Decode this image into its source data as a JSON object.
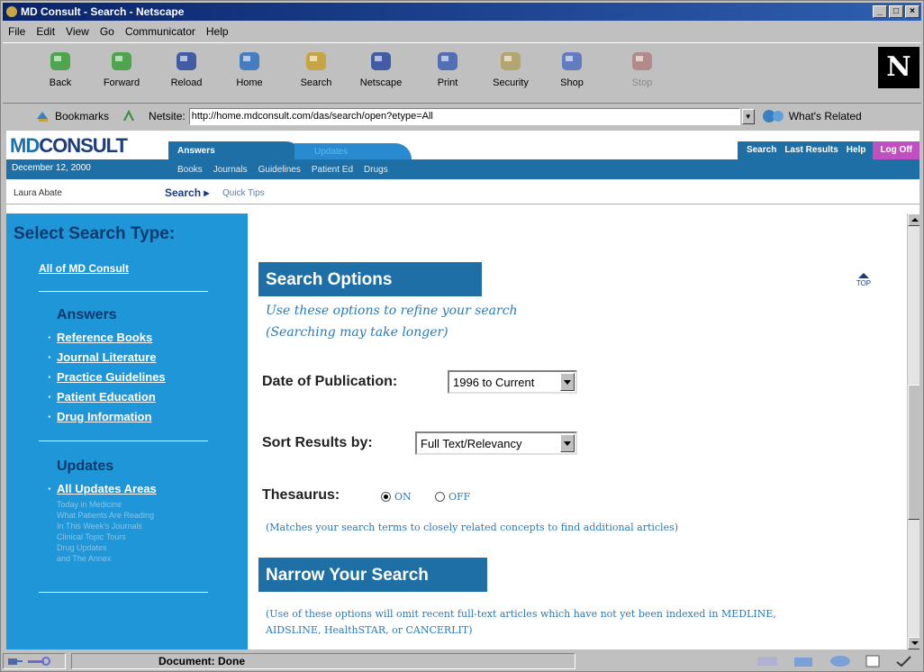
{
  "window": {
    "title": "MD Consult - Search - Netscape"
  },
  "menu": [
    "File",
    "Edit",
    "View",
    "Go",
    "Communicator",
    "Help"
  ],
  "toolbar": [
    {
      "label": "Back",
      "icon": "back-arrow-icon",
      "color": "#3aa03a"
    },
    {
      "label": "Forward",
      "icon": "forward-arrow-icon",
      "color": "#3aa03a"
    },
    {
      "label": "Reload",
      "icon": "reload-icon",
      "color": "#2a4aa0"
    },
    {
      "label": "Home",
      "icon": "home-icon",
      "color": "#3070c0"
    },
    {
      "label": "Search",
      "icon": "search-icon",
      "color": "#c8a030"
    },
    {
      "label": "Netscape",
      "icon": "netscape-icon",
      "color": "#2a4aa0"
    },
    {
      "label": "Print",
      "icon": "print-icon",
      "color": "#4060b0"
    },
    {
      "label": "Security",
      "icon": "lock-icon",
      "color": "#b0a060"
    },
    {
      "label": "Shop",
      "icon": "shop-bag-icon",
      "color": "#5070c0"
    },
    {
      "label": "Stop",
      "icon": "stop-icon",
      "color": "#b08080",
      "disabled": true
    }
  ],
  "brand_logo": "N",
  "location": {
    "bookmarks_label": "Bookmarks",
    "netsite_label": "Netsite:",
    "url": "http://home.mdconsult.com/das/search/open?etype=All",
    "related_label": "What's Related"
  },
  "md": {
    "logo_md": "MD",
    "logo_rest": "CONSULT",
    "date": "December 12, 2000",
    "tab_answers": "Answers",
    "tab_updates": "Updates",
    "sub_links": [
      "Books",
      "Journals",
      "Guidelines",
      "Patient Ed",
      "Drugs"
    ],
    "right_links": [
      "Search",
      "Last Results",
      "Help"
    ],
    "logoff": "Log Off",
    "user": "Laura Abate",
    "crumb": "Search ▸",
    "quick_tips": "Quick Tips"
  },
  "sidebar": {
    "heading": "Select Search Type:",
    "all": "All of MD Consult",
    "answers_title": "Answers",
    "answers": [
      "Reference Books",
      "Journal Literature",
      "Practice Guidelines",
      "Patient Education",
      "Drug Information"
    ],
    "updates_title": "Updates",
    "updates_link": "All Updates Areas",
    "updates_items": [
      "Today in Medicine",
      "What Patients Are Reading",
      "In This Week's Journals",
      "Clinical Topic Tours",
      "Drug Updates",
      "and The Annex"
    ]
  },
  "search_options": {
    "title": "Search Options",
    "top_label": "TOP",
    "desc1": "Use these options to refine your search",
    "desc2": "(Searching may take longer)",
    "date_label": "Date of Publication:",
    "date_value": "1996 to Current",
    "sort_label": "Sort Results by:",
    "sort_value": "Full Text/Relevancy",
    "thes_label": "Thesaurus:",
    "on_label": "ON",
    "off_label": "OFF",
    "thes_note": "(Matches your search terms to closely related concepts to find additional articles)"
  },
  "narrow": {
    "title": "Narrow Your Search",
    "note1": "(Use of these options will omit recent full-text articles which have not yet been indexed in MEDLINE,",
    "note2": "AIDSLINE, HealthSTAR, or CANCERLIT)"
  },
  "status": {
    "text": "Document: Done"
  }
}
